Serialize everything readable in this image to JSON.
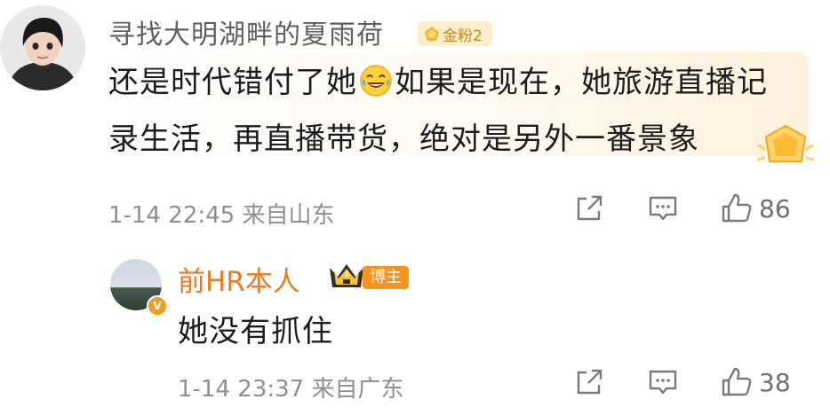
{
  "comment": {
    "username": "寻找大明湖畔的夏雨荷",
    "badge_label": "金粉2",
    "text_part1": "还是时代错付了她",
    "emoji": "laugh-cry-emoji",
    "text_part2": "如果是现在，她旅游直播记录生活，再直播带货，绝对是另外一番景象",
    "timestamp": "1-14 22:45",
    "location": "来自山东",
    "like_count": "86"
  },
  "reply": {
    "username": "前HR本人",
    "badge_label": "博主",
    "verified_mark": "V",
    "text": "她没有抓住",
    "timestamp": "1-14 23:37",
    "location": "来自广东",
    "like_count": "38"
  },
  "colors": {
    "reply_name": "#ea7a22",
    "gold_badge_bg": "#fbeec9",
    "blogger_badge_bg": "#f7931e"
  }
}
